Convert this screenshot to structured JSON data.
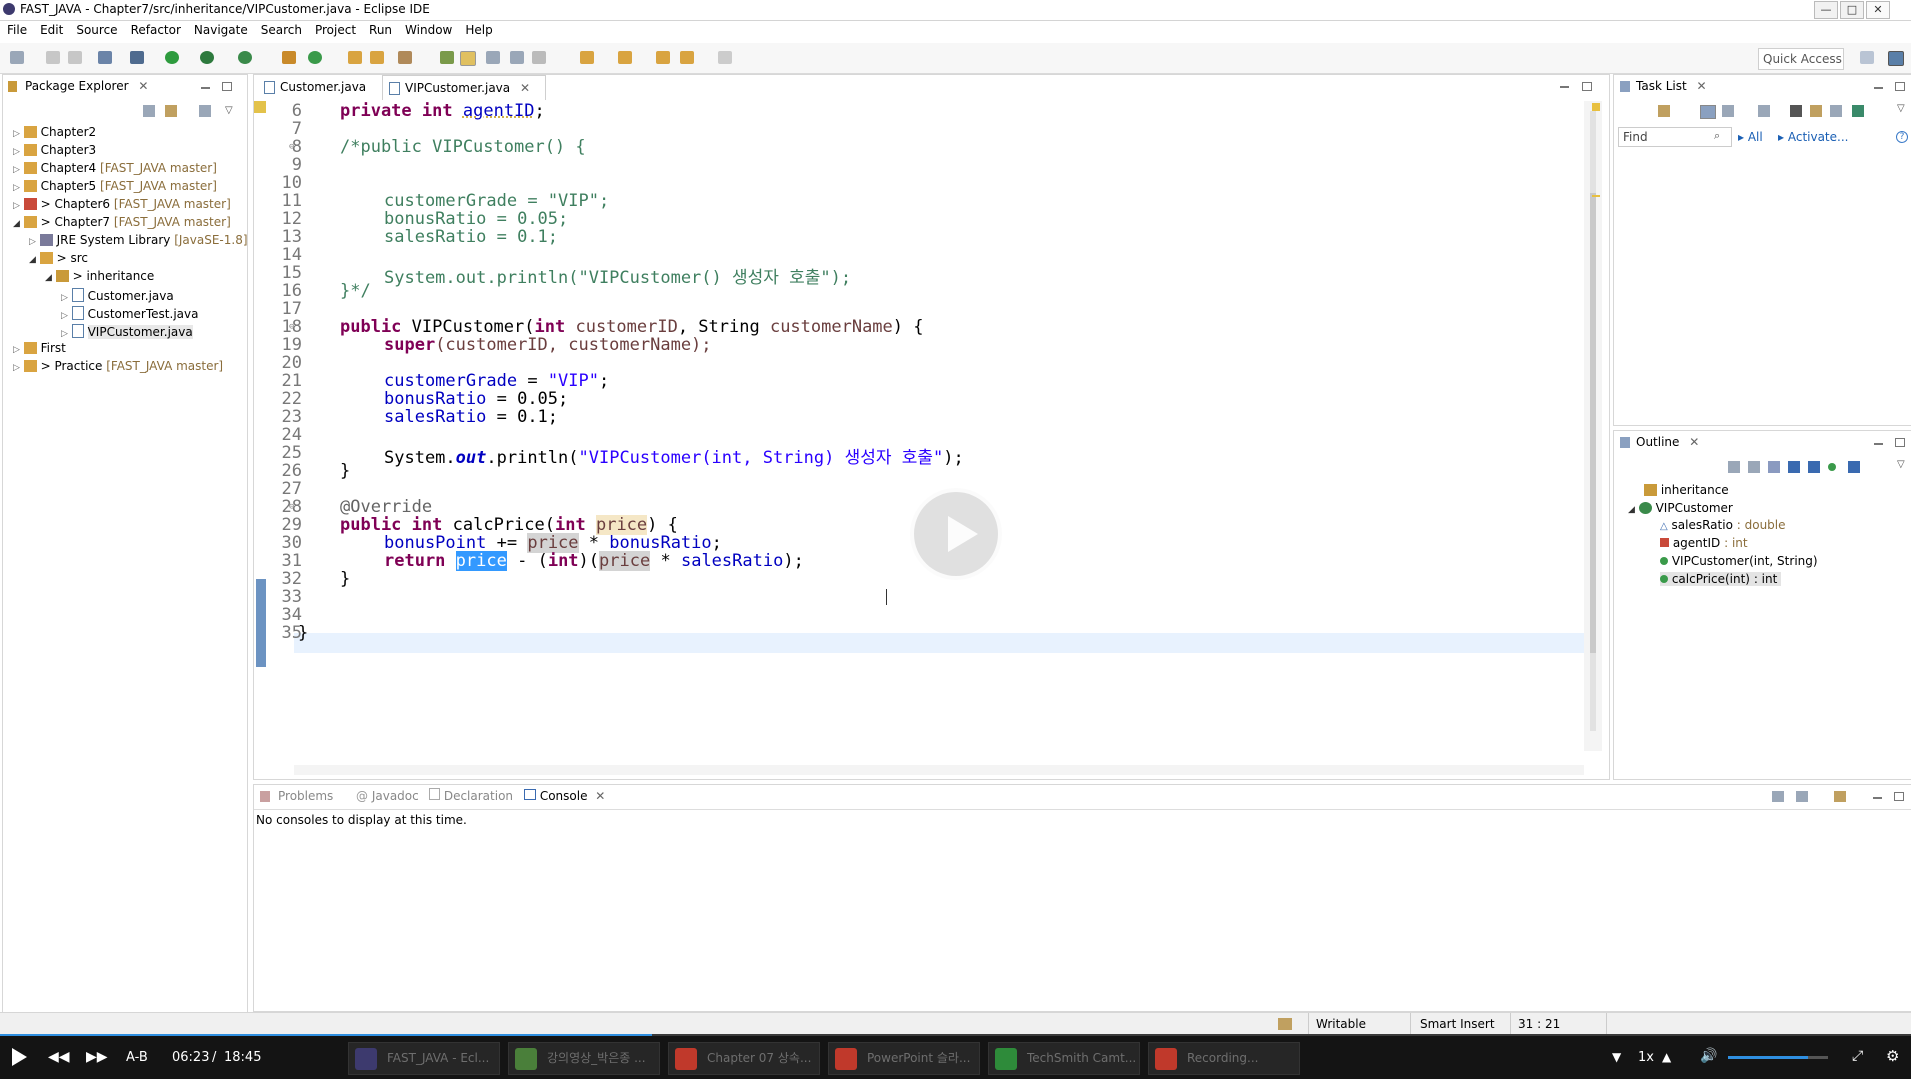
{
  "window": {
    "title": "FAST_JAVA - Chapter7/src/inheritance/VIPCustomer.java - Eclipse IDE",
    "min": "—",
    "max": "□",
    "close": "✕"
  },
  "menu": [
    "File",
    "Edit",
    "Source",
    "Refactor",
    "Navigate",
    "Search",
    "Project",
    "Run",
    "Window",
    "Help"
  ],
  "toolbar": {
    "quick_access": "Quick Access"
  },
  "package_explorer": {
    "title": "Package Explorer",
    "items": [
      {
        "label": "Chapter2",
        "deco": ""
      },
      {
        "label": "Chapter3",
        "deco": ""
      },
      {
        "label": "Chapter4",
        "deco": "[FAST_JAVA master]"
      },
      {
        "label": "Chapter5",
        "deco": "[FAST_JAVA master]"
      },
      {
        "label": "> Chapter6",
        "deco": "[FAST_JAVA master]"
      },
      {
        "label": "> Chapter7",
        "deco": "[FAST_JAVA master]"
      },
      {
        "label": "JRE System Library",
        "deco": "[JavaSE-1.8]"
      },
      {
        "label": "> src",
        "deco": ""
      },
      {
        "label": "> inheritance",
        "deco": ""
      },
      {
        "label": "Customer.java",
        "deco": ""
      },
      {
        "label": "CustomerTest.java",
        "deco": ""
      },
      {
        "label": "VIPCustomer.java",
        "deco": ""
      },
      {
        "label": "First",
        "deco": ""
      },
      {
        "label": "> Practice",
        "deco": "[FAST_JAVA master]"
      }
    ]
  },
  "editor": {
    "tabs": [
      "Customer.java",
      "VIPCustomer.java"
    ],
    "active_tab": "VIPCustomer.java",
    "line_numbers": [
      "6",
      "7",
      "8",
      "9",
      "10",
      "11",
      "12",
      "13",
      "14",
      "15",
      "16",
      "17",
      "18",
      "19",
      "20",
      "21",
      "22",
      "23",
      "24",
      "25",
      "26",
      "27",
      "28",
      "29",
      "30",
      "31",
      "32",
      "33",
      "34",
      "35"
    ],
    "code": {
      "l6": [
        "private",
        "int",
        "agentID",
        ";"
      ],
      "l8": "/*public VIPCustomer() {",
      "l11": [
        "customerGrade",
        "=",
        "\"VIP\"",
        ";"
      ],
      "l12": [
        "bonusRatio",
        "= 0.05;"
      ],
      "l13": [
        "salesRatio",
        "= 0.1;"
      ],
      "l15": [
        "System.out.println(",
        "\"VIPCustomer() 생성자 호출\"",
        ");"
      ],
      "l16": "}*/",
      "l18": [
        "public",
        "VIPCustomer(",
        "int",
        "customerID",
        ", String ",
        "customerName",
        ") {"
      ],
      "l19": [
        "super",
        "(customerID, customerName);"
      ],
      "l21": [
        "customerGrade",
        "=",
        "\"VIP\"",
        ";"
      ],
      "l22": [
        "bonusRatio",
        "= 0.05;"
      ],
      "l23": [
        "salesRatio",
        "= 0.1;"
      ],
      "l25": [
        "System.",
        "out",
        ".println(",
        "\"VIPCustomer(int, String) 생성자 호출\"",
        ");"
      ],
      "l26": "}",
      "l28": "@Override",
      "l29": [
        "public",
        "int",
        "calcPrice(",
        "int",
        "price",
        ") {"
      ],
      "l30": [
        "bonusPoint",
        "+=",
        "price",
        "*",
        "bonusRatio",
        ";"
      ],
      "l31": [
        "return",
        "price",
        "- (",
        "int",
        ")(",
        "price",
        "*",
        "salesRatio",
        ");"
      ],
      "l32": "}",
      "l35": "}"
    }
  },
  "task_list": {
    "title": "Task List",
    "find_placeholder": "Find",
    "all": "All",
    "activate": "Activate..."
  },
  "outline": {
    "title": "Outline",
    "items": [
      {
        "label": "inheritance",
        "type": ""
      },
      {
        "label": "VIPCustomer",
        "type": ""
      },
      {
        "label": "salesRatio",
        "type": ": double"
      },
      {
        "label": "agentID",
        "type": ": int"
      },
      {
        "label": "VIPCustomer(int, String)",
        "type": ""
      },
      {
        "label": "calcPrice(int)",
        "type": ": int"
      }
    ]
  },
  "console": {
    "tabs": [
      "Problems",
      "Javadoc",
      "Declaration",
      "Console"
    ],
    "active": "Console",
    "message": "No consoles to display at this time."
  },
  "status": {
    "writable": "Writable",
    "insert": "Smart Insert",
    "position": "31 : 21"
  },
  "player": {
    "ab": "A-B",
    "current": "06:23",
    "sep": "/",
    "total": "18:45",
    "progress": 0.341,
    "speed": "1x",
    "volume": 0.8,
    "apps": [
      {
        "label": "FAST_JAVA - Ecl...",
        "color": "#3d3a6e"
      },
      {
        "label": "강의영상_박은종 ...",
        "color": "#4a7f3a"
      },
      {
        "label": "Chapter 07 상속...",
        "color": "#c0392b"
      },
      {
        "label": "PowerPoint 슬라...",
        "color": "#c0392b"
      },
      {
        "label": "TechSmith Camt...",
        "color": "#2e8b3a"
      },
      {
        "label": "Recording...",
        "color": "#c0392b"
      }
    ]
  },
  "colors": {
    "accent": "#2f8fe0",
    "keyword": "#7f0055",
    "string": "#2a00ff",
    "comment": "#3f7f5f",
    "field": "#0000c0"
  }
}
